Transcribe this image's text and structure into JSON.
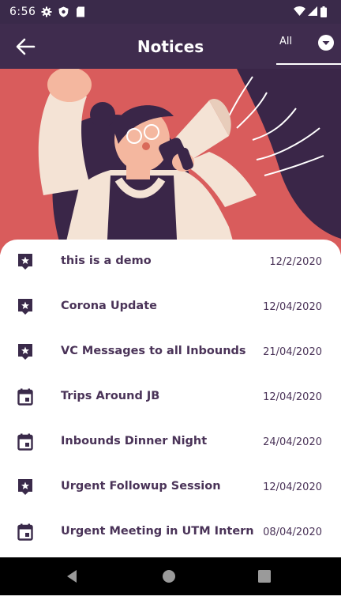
{
  "status_bar": {
    "time": "6:56"
  },
  "app_bar": {
    "title": "Notices",
    "filter_label": "All"
  },
  "colors": {
    "app_bar": "#3f2c4e",
    "hero_background": "#d95c5c",
    "accent_purple": "#4a3358",
    "icon_purple": "#3a2a4a"
  },
  "notices": [
    {
      "icon": "announcement-icon",
      "title": "this is a demo",
      "date": "12/2/2020"
    },
    {
      "icon": "announcement-icon",
      "title": "Corona Update",
      "date": "12/04/2020"
    },
    {
      "icon": "announcement-icon",
      "title": "VC Messages to all Inbounds",
      "date": "21/04/2020"
    },
    {
      "icon": "calendar-icon",
      "title": "Trips Around JB",
      "date": "12/04/2020"
    },
    {
      "icon": "calendar-icon",
      "title": "Inbounds Dinner Night",
      "date": "24/04/2020"
    },
    {
      "icon": "announcement-icon",
      "title": "Urgent Followup Session",
      "date": "12/04/2020"
    },
    {
      "icon": "calendar-icon",
      "title": "Urgent Meeting in UTM Internationl",
      "date": "08/04/2020"
    }
  ]
}
